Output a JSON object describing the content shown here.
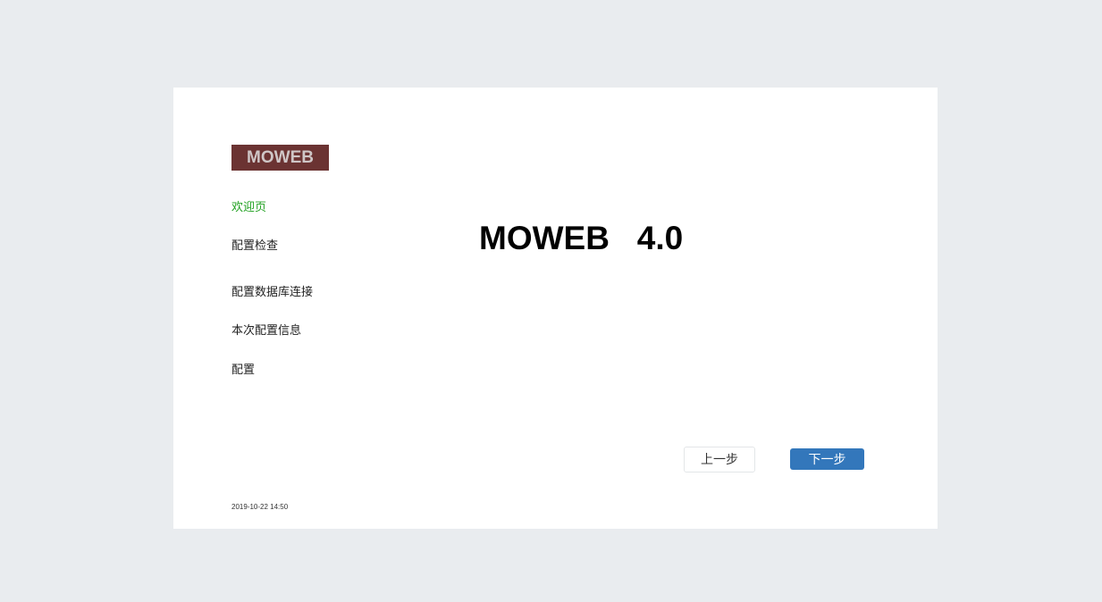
{
  "logo": {
    "text": "MOWEB"
  },
  "sidebar": {
    "items": [
      {
        "label": "欢迎页",
        "active": true
      },
      {
        "label": "配置检查",
        "active": false
      },
      {
        "label": "配置数据库连接",
        "active": false
      },
      {
        "label": "本次配置信息",
        "active": false
      },
      {
        "label": "配置",
        "active": false
      }
    ]
  },
  "main": {
    "title": "MOWEB   4.0"
  },
  "buttons": {
    "prev_label": "上一步",
    "next_label": "下一步"
  },
  "footer": {
    "timestamp": "2019-10-22 14:50"
  },
  "colors": {
    "background": "#e9ecef",
    "logo_bg": "#6b3332",
    "active_nav": "#21a121",
    "primary_button": "#3377bb"
  }
}
